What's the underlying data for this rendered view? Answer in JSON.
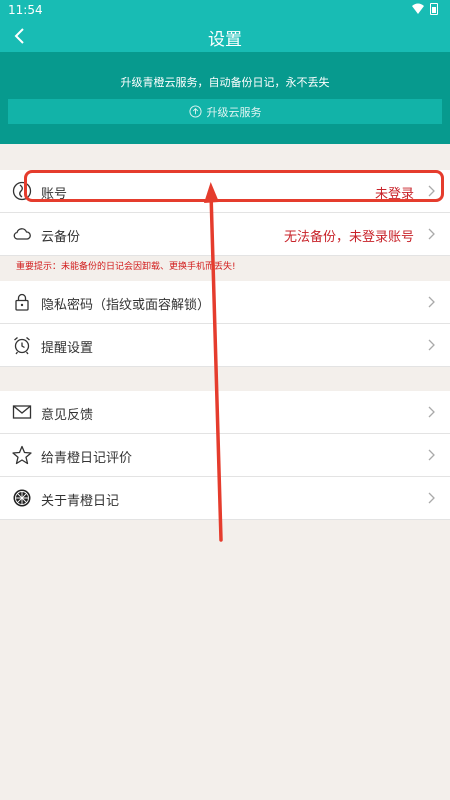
{
  "status": {
    "time": "11:54",
    "wifi_icon": "wifi-icon",
    "battery_icon": "battery-icon"
  },
  "header": {
    "title": "设置",
    "back_icon": "chevron-left-icon"
  },
  "promo": {
    "text": "升级青橙云服务，自动备份日记，永不丢失",
    "button_label": "升级云服务",
    "button_icon": "arrow-up-circle-icon"
  },
  "account_section": {
    "items": [
      {
        "label": "账号",
        "value": "未登录",
        "icon": "account-icon"
      },
      {
        "label": "云备份",
        "value": "无法备份，未登录账号",
        "icon": "cloud-icon"
      }
    ],
    "warning": "重要提示：未能备份的日记会因卸载、更换手机而丢失!"
  },
  "settings_section": {
    "items": [
      {
        "label": "隐私密码（指纹或面容解锁）",
        "icon": "lock-icon"
      },
      {
        "label": "提醒设置",
        "icon": "alarm-clock-icon"
      }
    ]
  },
  "about_section": {
    "items": [
      {
        "label": "意见反馈",
        "icon": "envelope-icon"
      },
      {
        "label": "给青橙日记评价",
        "icon": "star-icon"
      },
      {
        "label": "关于青橙日记",
        "icon": "orange-slice-icon"
      }
    ]
  },
  "colors": {
    "header": "#18bcb4",
    "promo": "#079a8e",
    "warning": "#d21c1c",
    "annotation": "#e53c2d"
  }
}
